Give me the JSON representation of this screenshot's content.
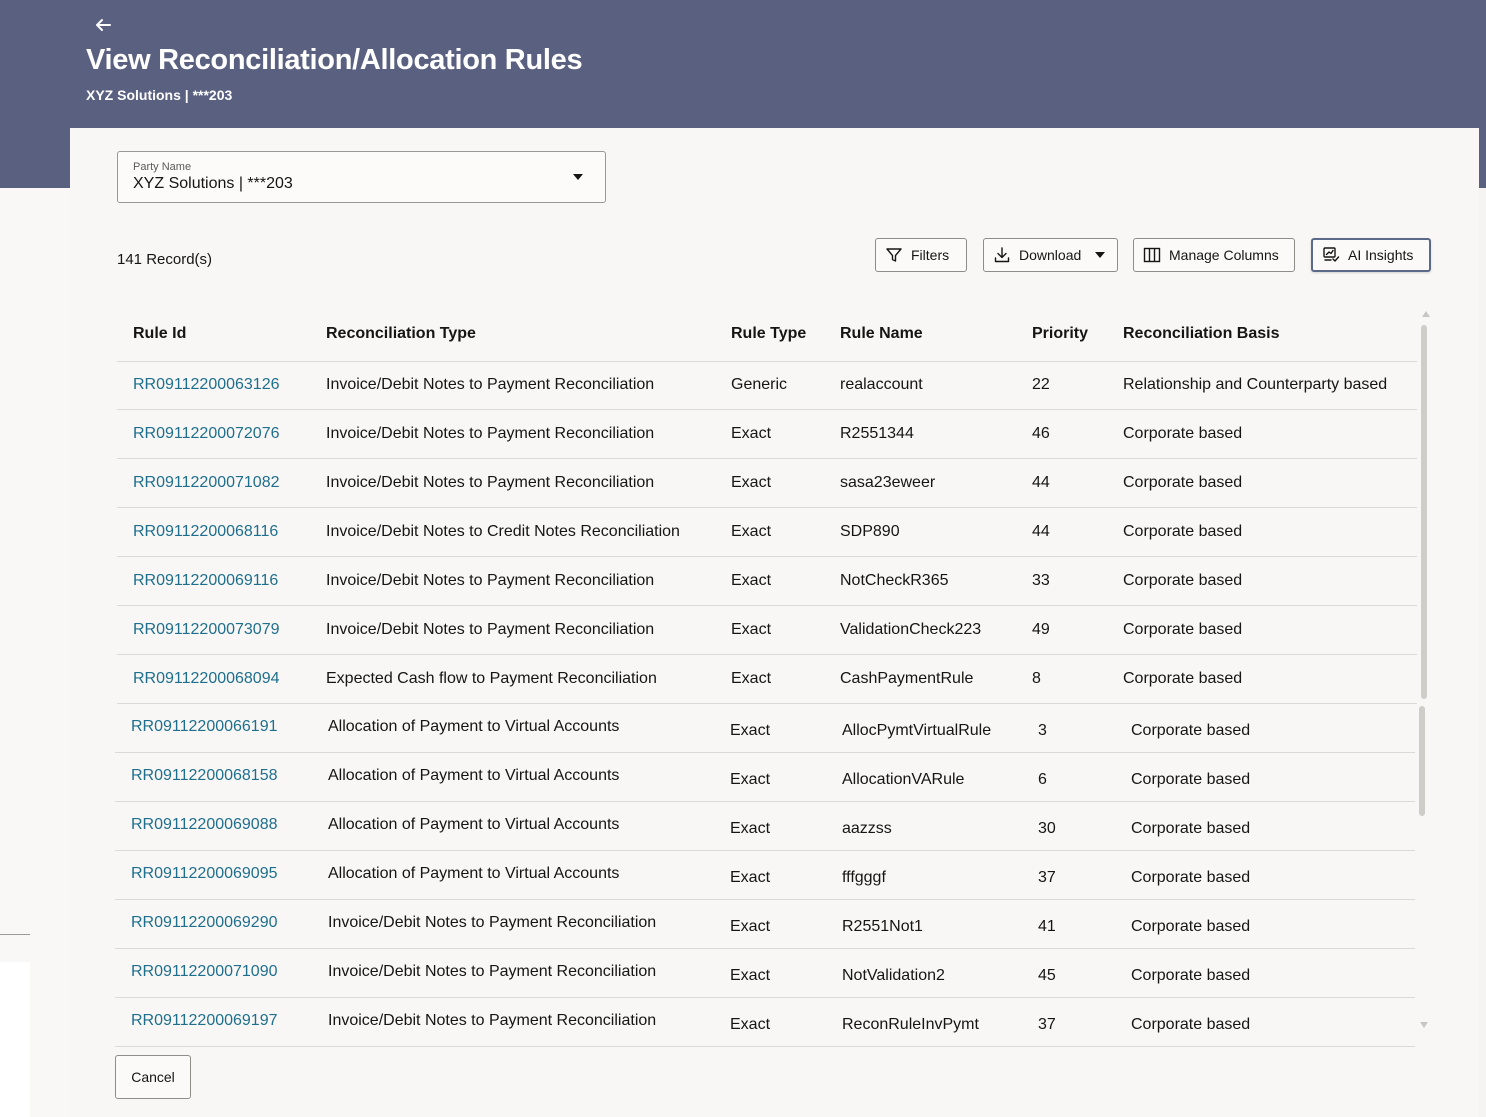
{
  "header": {
    "title": "View Reconciliation/Allocation Rules",
    "subtitle": "XYZ Solutions | ***203",
    "back_icon": "arrow-left-icon",
    "band_color": "#5a6080"
  },
  "party": {
    "label": "Party Name",
    "value": "XYZ Solutions | ***203"
  },
  "records": {
    "count_text": "141 Record(s)"
  },
  "toolbar": {
    "filters_label": "Filters",
    "download_label": "Download",
    "manage_columns_label": "Manage Columns",
    "ai_insights_label": "AI Insights"
  },
  "table": {
    "columns": [
      "Rule Id",
      "Reconciliation Type",
      "Rule Type",
      "Rule Name",
      "Priority",
      "Reconciliation Basis"
    ],
    "link_color": "#1e6f8e",
    "rows": [
      [
        "RR09112200063126",
        "Invoice/Debit Notes to Payment Reconciliation",
        "Generic",
        "realaccount",
        "22",
        "Relationship and Counterparty based"
      ],
      [
        "RR09112200072076",
        "Invoice/Debit Notes to Payment Reconciliation",
        "Exact",
        "R2551344",
        "46",
        "Corporate based"
      ],
      [
        "RR09112200071082",
        "Invoice/Debit Notes to Payment Reconciliation",
        "Exact",
        "sasa23eweer",
        "44",
        "Corporate based"
      ],
      [
        "RR09112200068116",
        "Invoice/Debit Notes to Credit Notes Reconciliation",
        "Exact",
        "SDP890",
        "44",
        "Corporate based"
      ],
      [
        "RR09112200069116",
        "Invoice/Debit Notes to Payment Reconciliation",
        "Exact",
        "NotCheckR365",
        "33",
        "Corporate based"
      ],
      [
        "RR09112200073079",
        "Invoice/Debit Notes to Payment Reconciliation",
        "Exact",
        "ValidationCheck223",
        "49",
        "Corporate based"
      ],
      [
        "RR09112200068094",
        "Expected Cash flow to Payment Reconciliation",
        "Exact",
        "CashPaymentRule",
        "8",
        "Corporate based"
      ],
      [
        "RR09112200066191",
        "Allocation of Payment to Virtual Accounts",
        "Exact",
        "AllocPymtVirtualRule",
        "3",
        "Corporate based"
      ],
      [
        "RR09112200068158",
        "Allocation of Payment to Virtual Accounts",
        "Exact",
        "AllocationVARule",
        "6",
        "Corporate based"
      ],
      [
        "RR09112200069088",
        "Allocation of Payment to Virtual Accounts",
        "Exact",
        "aazzss",
        "30",
        "Corporate based"
      ],
      [
        "RR09112200069095",
        "Allocation of Payment to Virtual Accounts",
        "Exact",
        "fffgggf",
        "37",
        "Corporate based"
      ],
      [
        "RR09112200069290",
        "Invoice/Debit Notes to Payment Reconciliation",
        "Exact",
        "R2551Not1",
        "41",
        "Corporate based"
      ],
      [
        "RR09112200071090",
        "Invoice/Debit Notes to Payment Reconciliation",
        "Exact",
        "NotValidation2",
        "45",
        "Corporate based"
      ],
      [
        "RR09112200069197",
        "Invoice/Debit Notes to Payment Reconciliation",
        "Exact",
        "ReconRuleInvPymt",
        "37",
        "Corporate based"
      ]
    ]
  },
  "footer": {
    "cancel_label": "Cancel"
  }
}
